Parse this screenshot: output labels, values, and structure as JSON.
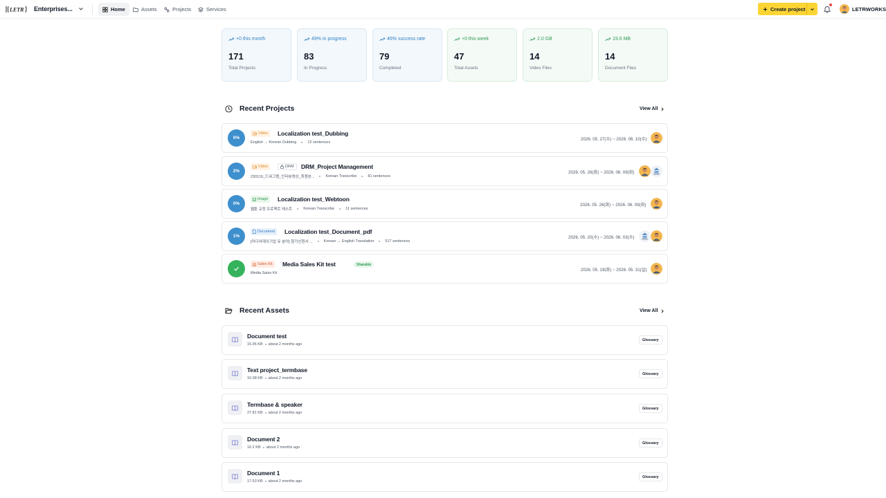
{
  "header": {
    "logo_text": "LETR",
    "org_name": "Enterprises...",
    "nav": [
      {
        "label": "Home",
        "icon": "home-icon",
        "active": true
      },
      {
        "label": "Assets",
        "icon": "folder-icon",
        "active": false
      },
      {
        "label": "Projects",
        "icon": "projects-icon",
        "active": false
      },
      {
        "label": "Services",
        "icon": "services-icon",
        "active": false
      }
    ],
    "create_label": "Create project",
    "user_name": "LETRWORKS"
  },
  "stats": [
    {
      "trend": "+0 this month",
      "value": "171",
      "label": "Total Projects",
      "tone": "blue"
    },
    {
      "trend": "49% in progress",
      "value": "83",
      "label": "In Progress",
      "tone": "blue"
    },
    {
      "trend": "46% success rate",
      "value": "79",
      "label": "Completed",
      "tone": "blue"
    },
    {
      "trend": "+0 this week",
      "value": "47",
      "label": "Total Assets",
      "tone": "green"
    },
    {
      "trend": "2.0 GB",
      "value": "14",
      "label": "Video Files",
      "tone": "green"
    },
    {
      "trend": "19.6 MB",
      "value": "14",
      "label": "Document Files",
      "tone": "green"
    }
  ],
  "recent_projects": {
    "title": "Recent Projects",
    "view_all": "View All",
    "items": [
      {
        "progress": "0%",
        "type": "Video",
        "drm": "",
        "title": "Localization test_Dubbing",
        "sub": [
          "English → Korean Dubbing",
          "12 sentences"
        ],
        "sub_prefix": "",
        "shareable": "",
        "dates": "2026. 05. 27(수) ~ 2026. 06. 10(수)"
      },
      {
        "progress": "2%",
        "type": "Video",
        "drm": "DRM",
        "title": "DRM_Project Management",
        "sub": [
          "230119_드워그램_인터뷰영상_최종본...",
          "Korean Transcribe",
          "81 sentences"
        ],
        "shareable": "",
        "dates": "2026. 05. 26(화) ~ 2026. 06. 09(화)"
      },
      {
        "progress": "0%",
        "type": "Image",
        "drm": "",
        "title": "Localization test_Webtoon",
        "sub": [
          "웹툰 교정 프로젝트 테스트",
          "Korean Transcribe",
          "11 sentences"
        ],
        "shareable": "",
        "dates": "2026. 05. 26(화) ~ 2026. 06. 09(화)"
      },
      {
        "progress": "1%",
        "type": "Document",
        "drm": "",
        "title": "Localization test_Document_pdf",
        "sub": [
          "[미디어데이기업 유 분야] 참가신청서 ...",
          "Korean → English Translation",
          "517 sentences"
        ],
        "shareable": "",
        "dates": "2026. 05. 20(수) ~ 2026. 06. 03(수)"
      },
      {
        "progress": "",
        "type": "Sales Kit",
        "drm": "",
        "title": "Media Sales Kit test",
        "sub": [
          "Media Sales Kit"
        ],
        "shareable": "Sharable",
        "dates": "2026. 05. 19(화) ~ 2026. 05. 31(일)"
      }
    ]
  },
  "recent_assets": {
    "title": "Recent Assets",
    "view_all": "View All",
    "items": [
      {
        "name": "Document test",
        "size": "15.96 KB",
        "time": "about 2 months ago",
        "tag": "Glossary"
      },
      {
        "name": "Text project_termbase",
        "size": "16.08 KB",
        "time": "about 2 months ago",
        "tag": "Glossary"
      },
      {
        "name": "Termbase & speaker",
        "size": "27.81 KB",
        "time": "about 2 months ago",
        "tag": "Glossary"
      },
      {
        "name": "Document 2",
        "size": "16.2 KB",
        "time": "about 2 months ago",
        "tag": "Glossary"
      },
      {
        "name": "Document 1",
        "size": "17.53 KB",
        "time": "about 2 months ago",
        "tag": "Glossary"
      }
    ]
  },
  "colors": {
    "accent": "#fcd534",
    "progress": "#3e8fcd",
    "done": "#34b35c"
  }
}
